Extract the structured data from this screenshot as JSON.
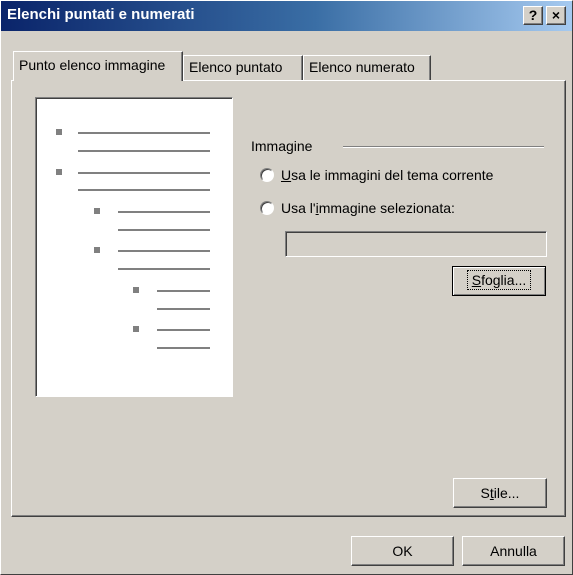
{
  "window": {
    "title": "Elenchi puntati e numerati",
    "help_button": "?",
    "close_button": "×"
  },
  "tabs": [
    {
      "label": "Punto elenco immagine",
      "active": true
    },
    {
      "label": "Elenco puntato",
      "active": false
    },
    {
      "label": "Elenco numerato",
      "active": false
    }
  ],
  "image_group": {
    "label": "Immagine",
    "option_theme": {
      "before": "",
      "accel": "U",
      "after": "sa le immagini del tema corrente",
      "selected": false
    },
    "option_selected": {
      "before": "Usa l'",
      "accel": "i",
      "after": "mmagine selezionata:",
      "selected": false
    },
    "path_value": "",
    "browse": {
      "accel": "S",
      "rest": "foglia..."
    }
  },
  "buttons": {
    "style": {
      "before": "S",
      "accel": "t",
      "after": "ile..."
    },
    "ok": "OK",
    "cancel": "Annulla"
  },
  "icons": {
    "bullet": "square-bullet-icon"
  }
}
